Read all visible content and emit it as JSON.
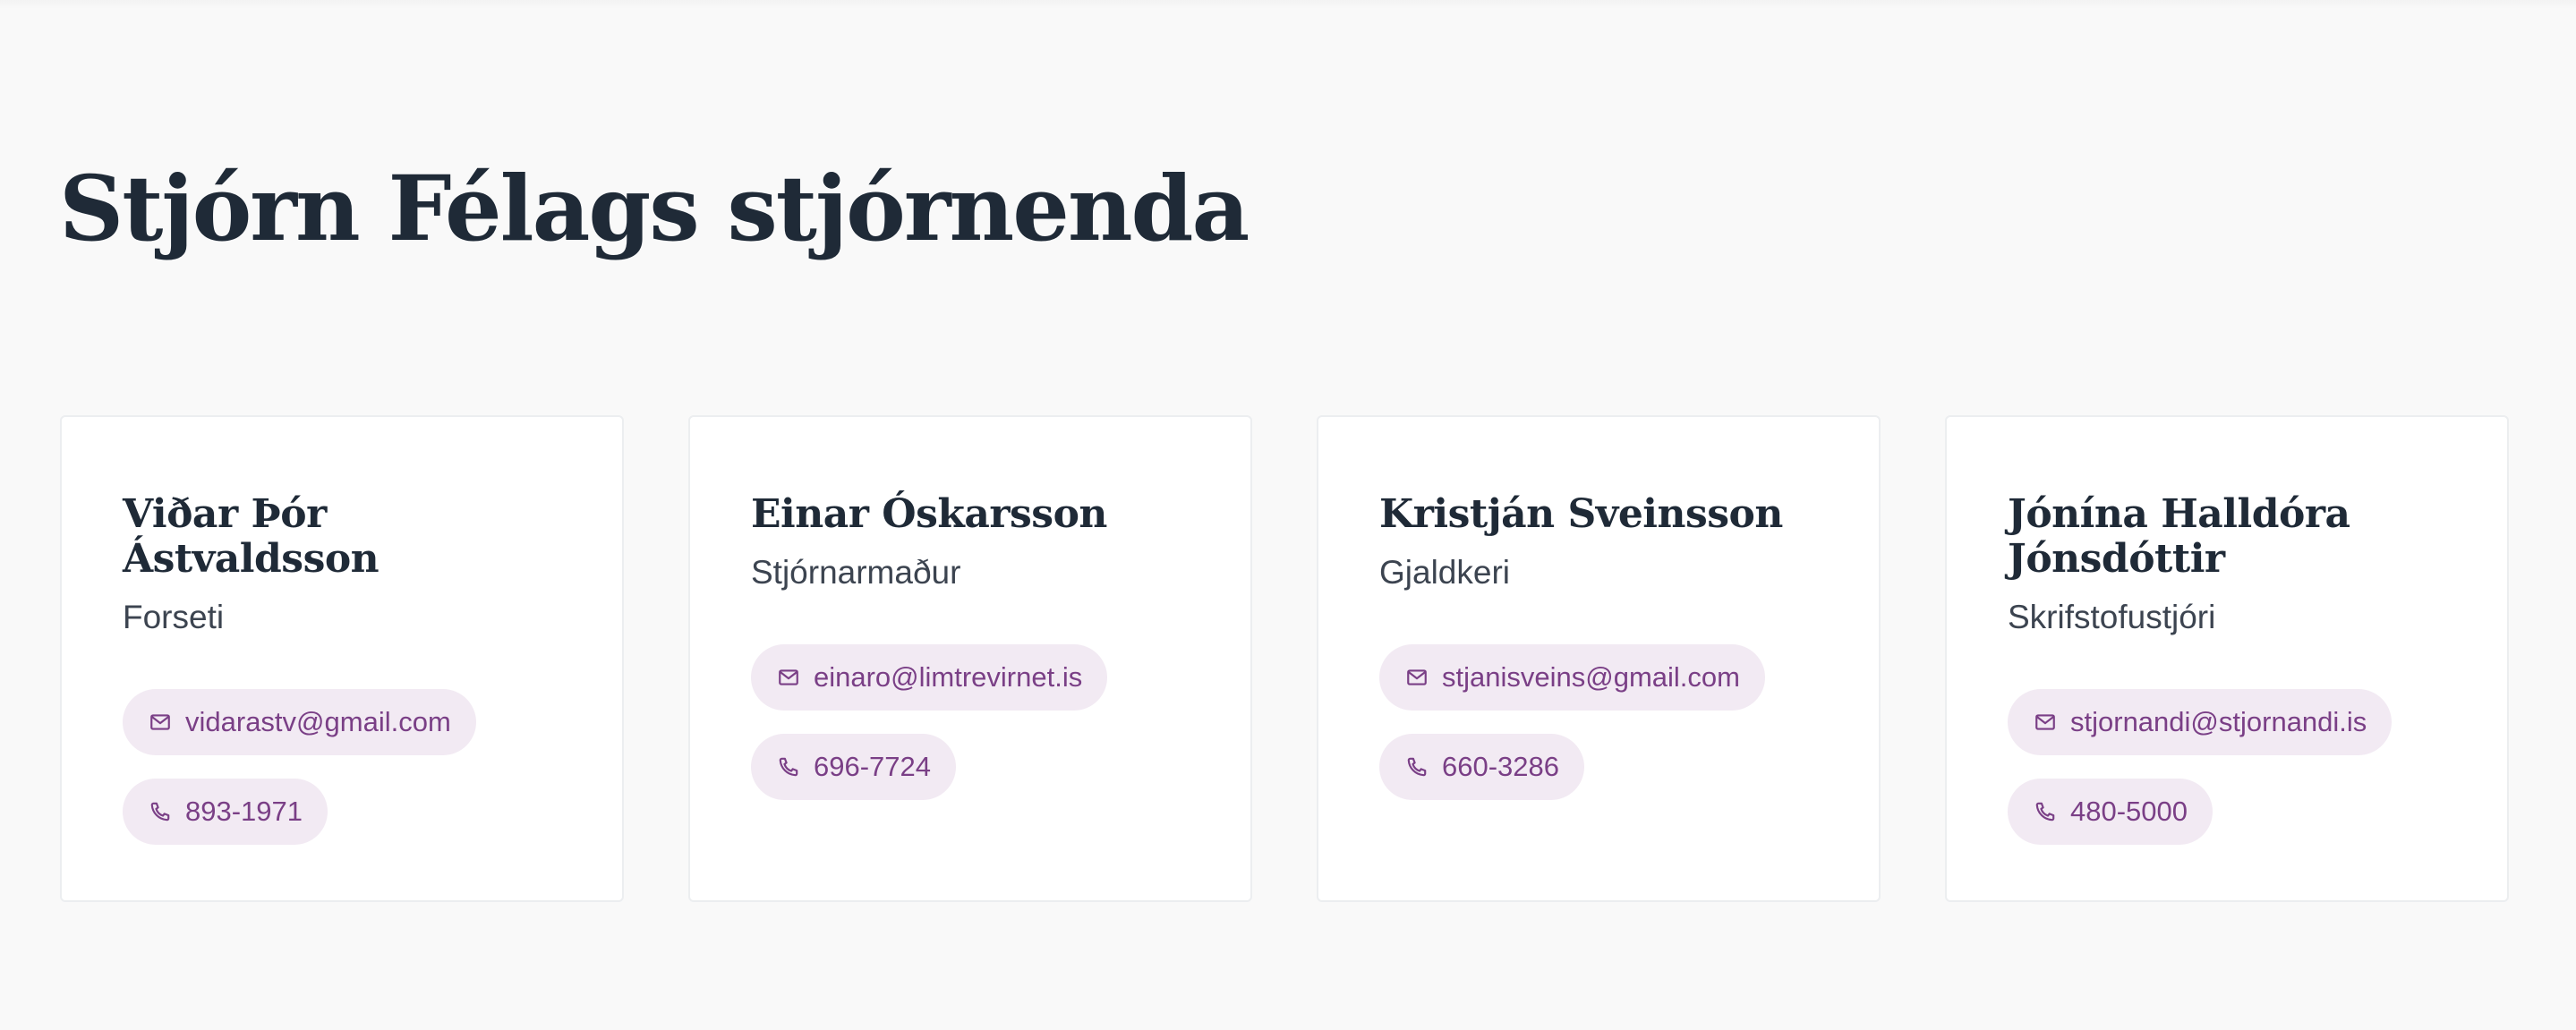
{
  "page": {
    "title": "Stjórn Félags stjórnenda"
  },
  "board": [
    {
      "name": "Viðar Þór Ástvaldsson",
      "role": "Forseti",
      "email": "vidarastv@gmail.com",
      "phone": "893-1971"
    },
    {
      "name": "Einar Óskarsson",
      "role": "Stjórnarmaður",
      "email": "einaro@limtrevirnet.is",
      "phone": "696-7724"
    },
    {
      "name": "Kristján Sveinsson",
      "role": "Gjaldkeri",
      "email": "stjanisveins@gmail.com",
      "phone": "660-3286"
    },
    {
      "name": "Jónína Halldóra Jónsdóttir",
      "role": "Skrifstofustjóri",
      "email": "stjornandi@stjornandi.is",
      "phone": "480-5000"
    }
  ],
  "icons": {
    "email": "mail-icon",
    "phone": "phone-icon"
  },
  "colors": {
    "background": "#f9f9f9",
    "heading": "#1f2a37",
    "chip_background": "#f2eaf3",
    "chip_text": "#7a3f86"
  }
}
